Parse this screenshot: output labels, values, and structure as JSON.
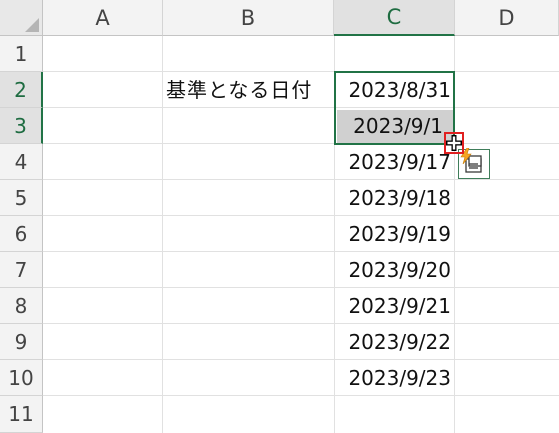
{
  "columns": [
    "A",
    "B",
    "C",
    "D"
  ],
  "rows": [
    "1",
    "2",
    "3",
    "4",
    "5",
    "6",
    "7",
    "8",
    "9",
    "10",
    "11"
  ],
  "cells": {
    "B2": "基準となる日付",
    "C2": "2023/8/31",
    "C3": "2023/9/1",
    "C4": "2023/9/17",
    "C5": "2023/9/18",
    "C6": "2023/9/19",
    "C7": "2023/9/20",
    "C8": "2023/9/21",
    "C9": "2023/9/22",
    "C10": "2023/9/23"
  },
  "selection": {
    "range": "C2:C3",
    "active_cell": "C3"
  },
  "colors": {
    "selection_border": "#217346",
    "fill_handle_highlight": "#e02020",
    "flash_fill": "#f5a623"
  },
  "icons": [
    "fill-handle-cross-cursor-icon",
    "auto-fill-options-icon",
    "flash-fill-icon"
  ]
}
